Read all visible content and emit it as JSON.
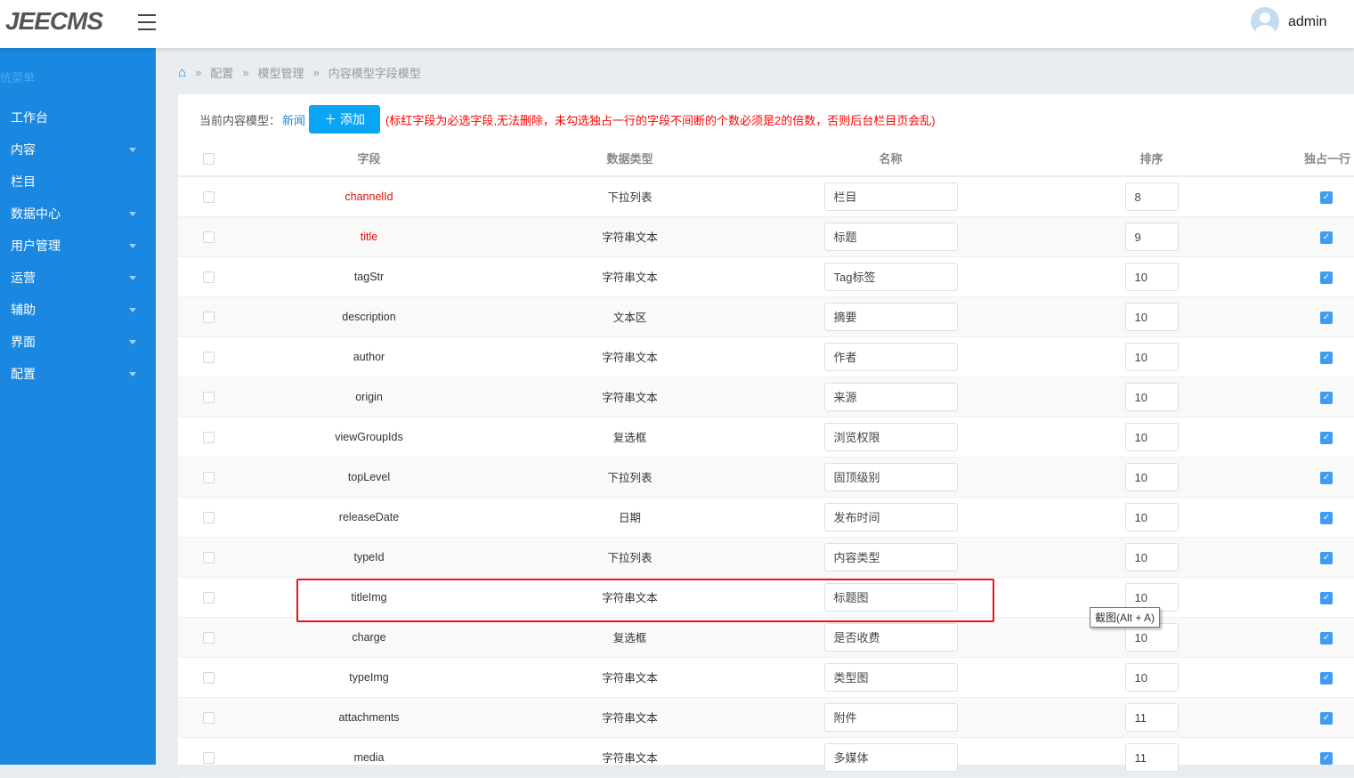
{
  "header": {
    "logo": "JEECMS",
    "user": "admin"
  },
  "sidebar": {
    "title": "统菜单",
    "items": [
      {
        "label": "工作台",
        "caret": false
      },
      {
        "label": "内容",
        "caret": true
      },
      {
        "label": "栏目",
        "caret": false
      },
      {
        "label": "数据中心",
        "caret": true
      },
      {
        "label": "用户管理",
        "caret": true
      },
      {
        "label": "运营",
        "caret": true
      },
      {
        "label": "辅助",
        "caret": true
      },
      {
        "label": "界面",
        "caret": true
      },
      {
        "label": "配置",
        "caret": true
      }
    ]
  },
  "breadcrumb": [
    "配置",
    "模型管理",
    "内容模型字段模型"
  ],
  "toolbar": {
    "label": "当前内容模型：",
    "model": "新闻",
    "add": "＋ 添加",
    "warning": "(标红字段为必选字段,无法删除，未勾选独占一行的字段不间断的个数必须是2的倍数，否则后台栏目页会乱)"
  },
  "columns": [
    "字段",
    "数据类型",
    "名称",
    "排序",
    "独占一行"
  ],
  "rows": [
    {
      "field": "channelId",
      "type": "下拉列表",
      "name": "栏目",
      "order": "8",
      "required": true
    },
    {
      "field": "title",
      "type": "字符串文本",
      "name": "标题",
      "order": "9",
      "required": true
    },
    {
      "field": "tagStr",
      "type": "字符串文本",
      "name": "Tag标签",
      "order": "10"
    },
    {
      "field": "description",
      "type": "文本区",
      "name": "摘要",
      "order": "10"
    },
    {
      "field": "author",
      "type": "字符串文本",
      "name": "作者",
      "order": "10"
    },
    {
      "field": "origin",
      "type": "字符串文本",
      "name": "来源",
      "order": "10"
    },
    {
      "field": "viewGroupIds",
      "type": "复选框",
      "name": "浏览权限",
      "order": "10"
    },
    {
      "field": "topLevel",
      "type": "下拉列表",
      "name": "固顶级别",
      "order": "10"
    },
    {
      "field": "releaseDate",
      "type": "日期",
      "name": "发布时间",
      "order": "10"
    },
    {
      "field": "typeId",
      "type": "下拉列表",
      "name": "内容类型",
      "order": "10"
    },
    {
      "field": "titleImg",
      "type": "字符串文本",
      "name": "标题图",
      "order": "10"
    },
    {
      "field": "charge",
      "type": "复选框",
      "name": "是否收费",
      "order": "10"
    },
    {
      "field": "typeImg",
      "type": "字符串文本",
      "name": "类型图",
      "order": "10"
    },
    {
      "field": "attachments",
      "type": "字符串文本",
      "name": "附件",
      "order": "11"
    },
    {
      "field": "media",
      "type": "字符串文本",
      "name": "多媒体",
      "order": "11"
    }
  ],
  "tooltip": "截图(Alt + A)"
}
